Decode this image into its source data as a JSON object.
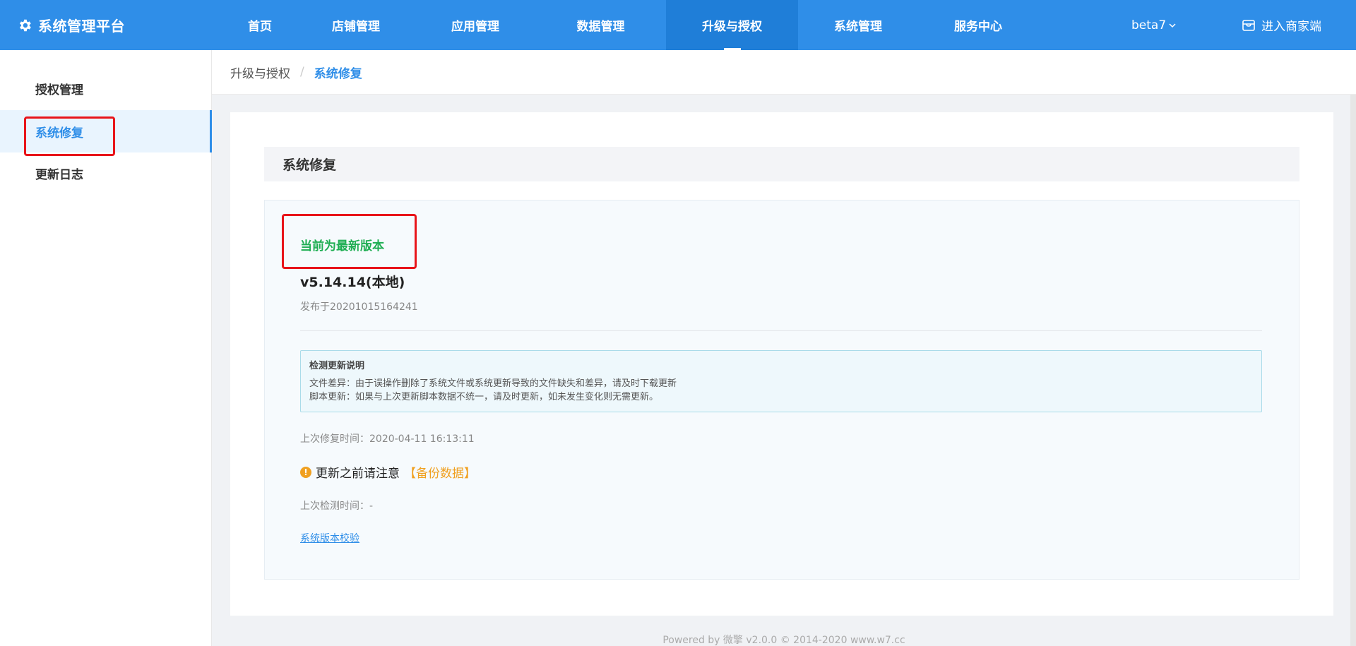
{
  "header": {
    "brand": "系统管理平台",
    "nav": [
      {
        "label": "首页",
        "active": false
      },
      {
        "label": "店铺管理",
        "active": false
      },
      {
        "label": "应用管理",
        "active": false
      },
      {
        "label": "数据管理",
        "active": false
      },
      {
        "label": "升级与授权",
        "active": true
      },
      {
        "label": "系统管理",
        "active": false
      },
      {
        "label": "服务中心",
        "active": false
      }
    ],
    "version_selector": "beta7",
    "merchant_link": "进入商家端"
  },
  "sidebar": {
    "items": [
      {
        "label": "授权管理",
        "active": false
      },
      {
        "label": "系统修复",
        "active": true
      },
      {
        "label": "更新日志",
        "active": false
      }
    ]
  },
  "breadcrumb": {
    "parent": "升级与授权",
    "separator": "/",
    "current": "系统修复"
  },
  "main": {
    "section_title": "系统修复",
    "status": "当前为最新版本",
    "version": "v5.14.14(本地)",
    "release": "发布于20201015164241",
    "notice": {
      "title": "检测更新说明",
      "line1": "文件差异：由于误操作删除了系统文件或系统更新导致的文件缺失和差异，请及时下载更新",
      "line2": "脚本更新：如果与上次更新脚本数据不统一，请及时更新，如未发生变化则无需更新。"
    },
    "last_repair": "上次修复时间：2020-04-11 16:13:11",
    "warning": "更新之前请注意",
    "warning_highlight": "【备份数据】",
    "last_check": "上次检测时间：-",
    "verify_link": "系统版本校验"
  },
  "footer": "Powered by 微擎 v2.0.0 © 2014-2020 www.w7.cc",
  "colors": {
    "primary": "#2f8ee8",
    "success": "#1fae53",
    "warning": "#f0a020",
    "highlight_box": "#e8141a"
  }
}
